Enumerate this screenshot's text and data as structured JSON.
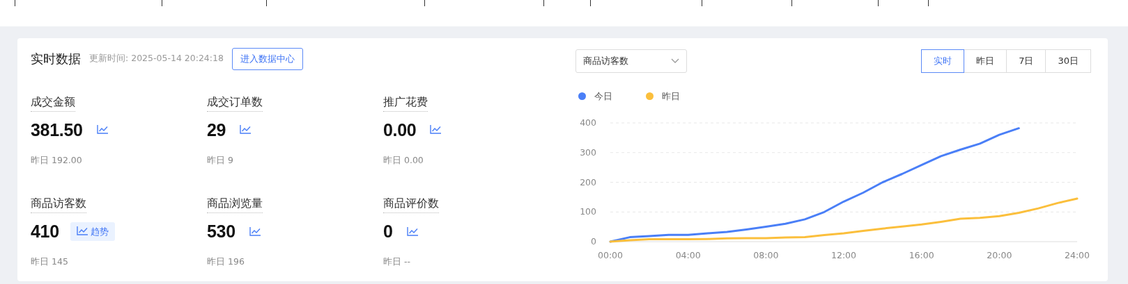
{
  "header": {
    "title": "实时数据",
    "updated": "更新时间: 2025-05-14 20:24:18",
    "button": "进入数据中心"
  },
  "metrics": [
    {
      "label": "成交金额",
      "value": "381.50",
      "yesterday": "昨日 192.00"
    },
    {
      "label": "成交订单数",
      "value": "29",
      "yesterday": "昨日 9"
    },
    {
      "label": "推广花费",
      "value": "0.00",
      "yesterday": "昨日 0.00"
    },
    {
      "label": "商品访客数",
      "value": "410",
      "trend_label": "趋势",
      "yesterday": "昨日 145"
    },
    {
      "label": "商品浏览量",
      "value": "530",
      "yesterday": "昨日 196"
    },
    {
      "label": "商品评价数",
      "value": "0",
      "yesterday": "昨日 --"
    }
  ],
  "metric_select": {
    "value": "商品访客数"
  },
  "ranges": [
    {
      "label": "实时",
      "selected": true
    },
    {
      "label": "昨日",
      "selected": false
    },
    {
      "label": "7日",
      "selected": false
    },
    {
      "label": "30日",
      "selected": false
    }
  ],
  "chart": {
    "chart_data": {
      "type": "line",
      "x": [
        0,
        1,
        2,
        3,
        4,
        5,
        6,
        7,
        8,
        9,
        10,
        11,
        12,
        13,
        14,
        15,
        16,
        17,
        18,
        19,
        20,
        21,
        22,
        23,
        24
      ],
      "xlim": [
        0,
        24
      ],
      "ylim": [
        0,
        400
      ],
      "xticks": [
        {
          "value": 0,
          "label": "00:00"
        },
        {
          "value": 4,
          "label": "04:00"
        },
        {
          "value": 8,
          "label": "08:00"
        },
        {
          "value": 12,
          "label": "12:00"
        },
        {
          "value": 16,
          "label": "16:00"
        },
        {
          "value": 20,
          "label": "20:00"
        },
        {
          "value": 24,
          "label": "24:00"
        }
      ],
      "yticks": [
        0,
        100,
        200,
        300,
        400
      ],
      "grid": true,
      "series": [
        {
          "name": "今日",
          "color": "#4a7ff7",
          "values": [
            0,
            15,
            19,
            23,
            23,
            28,
            33,
            41,
            50,
            60,
            75,
            100,
            135,
            165,
            200,
            228,
            258,
            288,
            310,
            330,
            360,
            382,
            null,
            null,
            null
          ]
        },
        {
          "name": "昨日",
          "color": "#fbbf3c",
          "values": [
            0,
            5,
            8,
            8,
            8,
            9,
            11,
            12,
            12,
            14,
            15,
            22,
            28,
            36,
            44,
            51,
            58,
            67,
            77,
            80,
            86,
            97,
            112,
            130,
            145
          ]
        }
      ]
    }
  }
}
